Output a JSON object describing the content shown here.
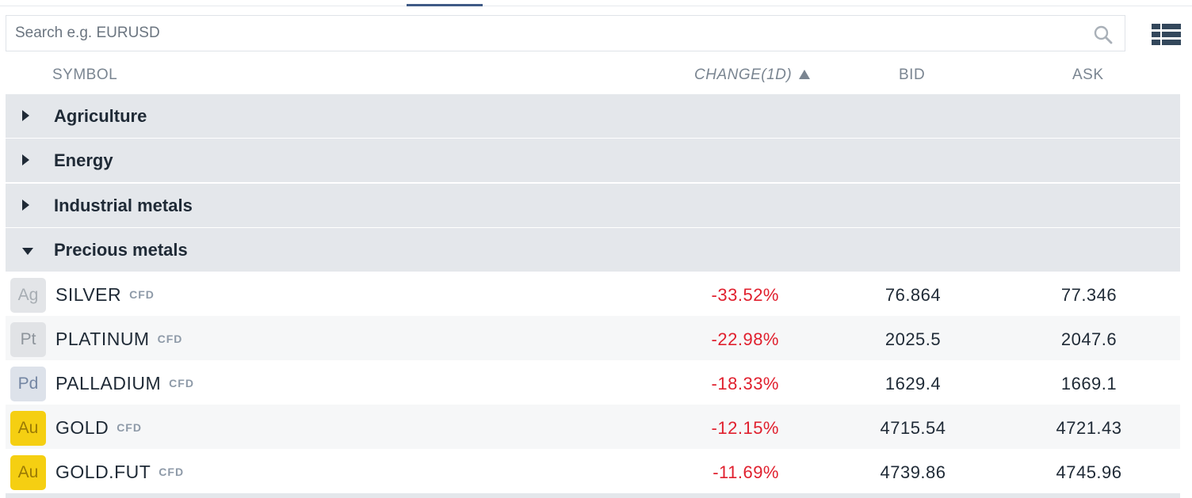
{
  "search": {
    "placeholder": "Search e.g. EURUSD",
    "value": ""
  },
  "columns": {
    "symbol": "SYMBOL",
    "change": "CHANGE(1D)",
    "bid": "BID",
    "ask": "ASK"
  },
  "groups": [
    {
      "label": "Agriculture",
      "expanded": false
    },
    {
      "label": "Energy",
      "expanded": false
    },
    {
      "label": "Industrial metals",
      "expanded": false
    },
    {
      "label": "Precious metals",
      "expanded": true
    }
  ],
  "instruments": [
    {
      "badge": "Ag",
      "name": "SILVER",
      "type": "CFD",
      "change": "-33.52%",
      "bid": "76.864",
      "ask": "77.346"
    },
    {
      "badge": "Pt",
      "name": "PLATINUM",
      "type": "CFD",
      "change": "-22.98%",
      "bid": "2025.5",
      "ask": "2047.6"
    },
    {
      "badge": "Pd",
      "name": "PALLADIUM",
      "type": "CFD",
      "change": "-18.33%",
      "bid": "1629.4",
      "ask": "1669.1"
    },
    {
      "badge": "Au",
      "name": "GOLD",
      "type": "CFD",
      "change": "-12.15%",
      "bid": "4715.54",
      "ask": "4721.43"
    },
    {
      "badge": "Au",
      "name": "GOLD.FUT",
      "type": "CFD",
      "change": "-11.69%",
      "bid": "4739.86",
      "ask": "4745.96"
    }
  ],
  "colors": {
    "negative": "#e0202e",
    "group_bg": "#e4e7eb",
    "gold_badge": "#f5cf12"
  },
  "icons": {
    "search": "search-icon",
    "view_toggle": "grid-view-icon",
    "sort": "sort-up-icon"
  }
}
